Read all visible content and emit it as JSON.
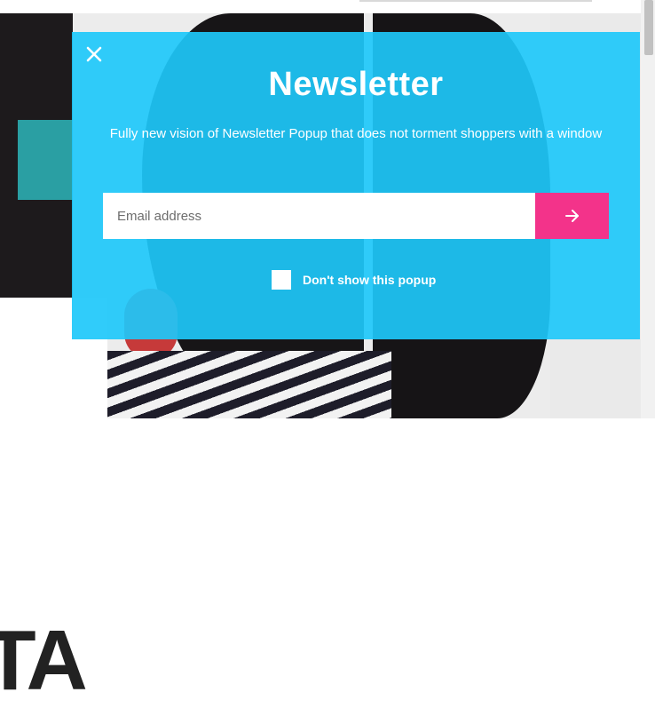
{
  "background": {
    "hero_text": "TA"
  },
  "popup": {
    "title": "Newsletter",
    "subtitle": "Fully new vision of Newsletter Popup that does not torment shoppers with a window",
    "close_icon": "close-icon",
    "email": {
      "value": "",
      "placeholder": "Email address"
    },
    "submit_icon": "arrow-right-icon",
    "dont_show_label": "Don't show this popup",
    "dont_show_checked": false
  },
  "colors": {
    "popup_bg": "#1ec8fa",
    "submit_bg": "#f3338a",
    "text": "#ffffff"
  }
}
